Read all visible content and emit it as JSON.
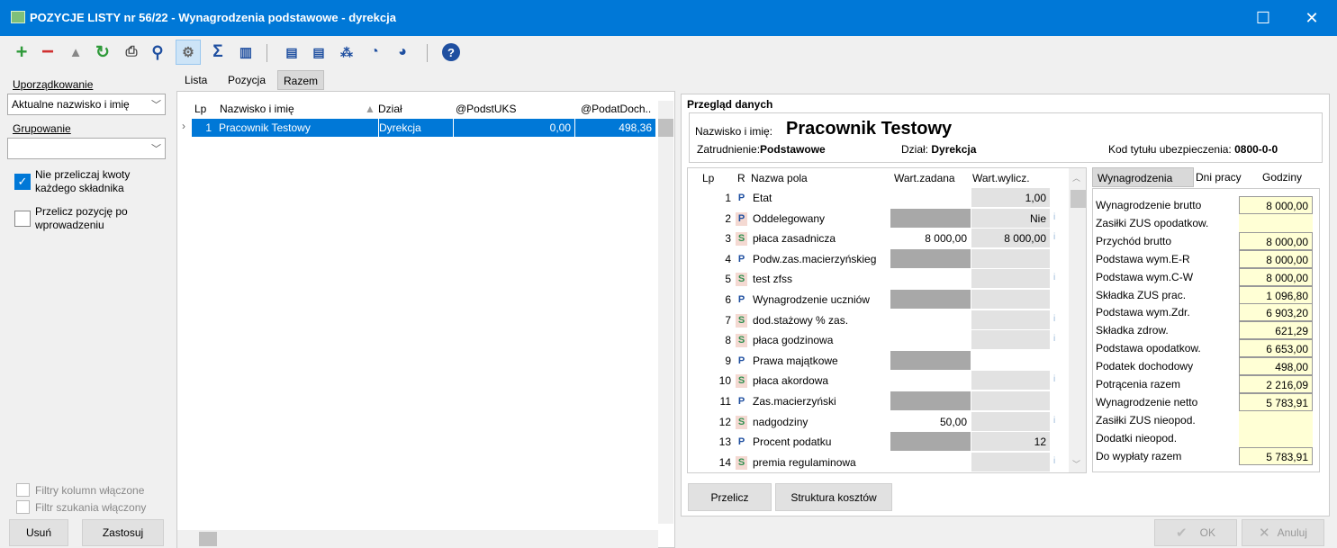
{
  "window": {
    "title": "POZYCJE LISTY nr 56/22 - Wynagrodzenia podstawowe - dyrekcja",
    "max_glyph": "☐",
    "close_glyph": "✕"
  },
  "toolbar": {
    "icons": [
      "plus-icon",
      "minus-icon",
      "triangle-icon",
      "refresh-icon",
      "print-icon",
      "search-icon",
      "settings-icon",
      "sigma-icon",
      "columns-icon",
      "report-icon",
      "report2-icon",
      "users-x-icon",
      "cycle-icon",
      "search-cycle-icon",
      "help-icon"
    ]
  },
  "left": {
    "sort_label": "Uporządkowanie",
    "sort_value": "Aktualne nazwisko i imię",
    "group_label": "Grupowanie",
    "group_value": "",
    "chk1_label": "Nie przeliczaj kwoty\nkażdego składnika",
    "chk1": true,
    "chk2_label": "Przelicz pozycję po\nwprowadzeniu",
    "chk2": false,
    "filter_cols": "Filtry kolumn włączone",
    "filter_search": "Filtr szukania włączony",
    "delete_btn": "Usuń",
    "apply_btn": "Zastosuj"
  },
  "tabs": {
    "lista": "Lista",
    "pozycja": "Pozycja",
    "razem": "Razem"
  },
  "grid": {
    "cols": {
      "lp": "Lp",
      "name": "Nazwisko i imię",
      "dzial": "Dział",
      "podst": "@PodstUKS",
      "podat": "@PodatDoch.."
    },
    "row": {
      "lp": "1",
      "name": "Pracownik Testowy",
      "dzial": "Dyrekcja",
      "podst": "0,00",
      "podat": "498,36"
    }
  },
  "overview": {
    "title": "Przegląd danych",
    "name_label": "Nazwisko i imię:",
    "name_value": "Pracownik Testowy",
    "zatr_label": "Zatrudnienie:",
    "zatr_value": "Podstawowe",
    "dzial_label": "Dział:",
    "dzial_value": "Dyrekcja",
    "kod_label": "Kod tytułu ubezpieczenia:",
    "kod_value": "0800-0-0"
  },
  "fields": {
    "cols": {
      "lp": "Lp",
      "r": "R",
      "name": "Nazwa pola",
      "zad": "Wart.zadana",
      "wyl": "Wart.wylicz."
    },
    "rows": [
      {
        "lp": "1",
        "r": "P",
        "name": "Etat",
        "zad": "",
        "wyl": "1,00",
        "zg": false,
        "wg": true,
        "info": false
      },
      {
        "lp": "2",
        "r": "P",
        "name": "Oddelegowany",
        "zad": "",
        "wyl": "Nie",
        "zg": true,
        "wg": true,
        "info": true,
        "box": true
      },
      {
        "lp": "3",
        "r": "S",
        "name": "płaca zasadnicza",
        "zad": "8 000,00",
        "wyl": "8 000,00",
        "zg": false,
        "wg": true,
        "info": true
      },
      {
        "lp": "4",
        "r": "P",
        "name": "Podw.zas.macierzyńskieg",
        "zad": "",
        "wyl": "",
        "zg": true,
        "wg": true,
        "info": false
      },
      {
        "lp": "5",
        "r": "S",
        "name": "test zfss",
        "zad": "",
        "wyl": "",
        "zg": false,
        "wg": true,
        "info": true
      },
      {
        "lp": "6",
        "r": "P",
        "name": "Wynagrodzenie uczniów",
        "zad": "",
        "wyl": "",
        "zg": true,
        "wg": true,
        "info": false
      },
      {
        "lp": "7",
        "r": "S",
        "name": "dod.stażowy % zas.",
        "zad": "",
        "wyl": "",
        "zg": false,
        "wg": true,
        "info": true
      },
      {
        "lp": "8",
        "r": "S",
        "name": "płaca godzinowa",
        "zad": "",
        "wyl": "",
        "zg": false,
        "wg": true,
        "info": true
      },
      {
        "lp": "9",
        "r": "P",
        "name": "Prawa majątkowe",
        "zad": "",
        "wyl": "",
        "zg": true,
        "wg": false,
        "info": false
      },
      {
        "lp": "10",
        "r": "S",
        "name": "płaca akordowa",
        "zad": "",
        "wyl": "",
        "zg": false,
        "wg": true,
        "info": true
      },
      {
        "lp": "11",
        "r": "P",
        "name": "Zas.macierzyński",
        "zad": "",
        "wyl": "",
        "zg": true,
        "wg": true,
        "info": false
      },
      {
        "lp": "12",
        "r": "S",
        "name": "nadgodziny",
        "zad": "50,00",
        "wyl": "",
        "zg": false,
        "wg": true,
        "info": true
      },
      {
        "lp": "13",
        "r": "P",
        "name": "Procent podatku",
        "zad": "",
        "wyl": "12",
        "zg": true,
        "wg": true,
        "info": false
      },
      {
        "lp": "14",
        "r": "S",
        "name": "premia regulaminowa",
        "zad": "",
        "wyl": "",
        "zg": false,
        "wg": true,
        "info": true
      }
    ]
  },
  "subtabs": {
    "wyn": "Wynagrodzenia",
    "dni": "Dni pracy",
    "godz": "Godziny"
  },
  "summary": [
    {
      "label": "Wynagrodzenie brutto",
      "value": "8 000,00",
      "box": true
    },
    {
      "label": "Zasiłki ZUS opodatkow.",
      "value": "",
      "box": false
    },
    {
      "label": "Przychód brutto",
      "value": "8 000,00",
      "box": true
    },
    {
      "label": "Podstawa wym.E-R",
      "value": "8 000,00",
      "box": true
    },
    {
      "label": "Podstawa wym.C-W",
      "value": "8 000,00",
      "box": true
    },
    {
      "label": "Składka ZUS prac.",
      "value": "1 096,80",
      "box": true
    },
    {
      "label": "Podstawa wym.Zdr.",
      "value": "6 903,20",
      "box": true
    },
    {
      "label": "Składka zdrow.",
      "value": "621,29",
      "box": true
    },
    {
      "label": "Podstawa opodatkow.",
      "value": "6 653,00",
      "box": true
    },
    {
      "label": "Podatek dochodowy",
      "value": "498,00",
      "box": true
    },
    {
      "label": "Potrącenia razem",
      "value": "2 216,09",
      "box": true
    },
    {
      "label": "Wynagrodzenie netto",
      "value": "5 783,91",
      "box": true
    },
    {
      "label": "Zasiłki ZUS nieopod.",
      "value": "",
      "box": false
    },
    {
      "label": "Dodatki nieopod.",
      "value": "",
      "box": false
    },
    {
      "label": "Do wypłaty razem",
      "value": "5 783,91",
      "box": true
    }
  ],
  "buttons": {
    "przelicz": "Przelicz",
    "struktura": "Struktura kosztów",
    "ok": "OK",
    "anuluj": "Anuluj"
  }
}
